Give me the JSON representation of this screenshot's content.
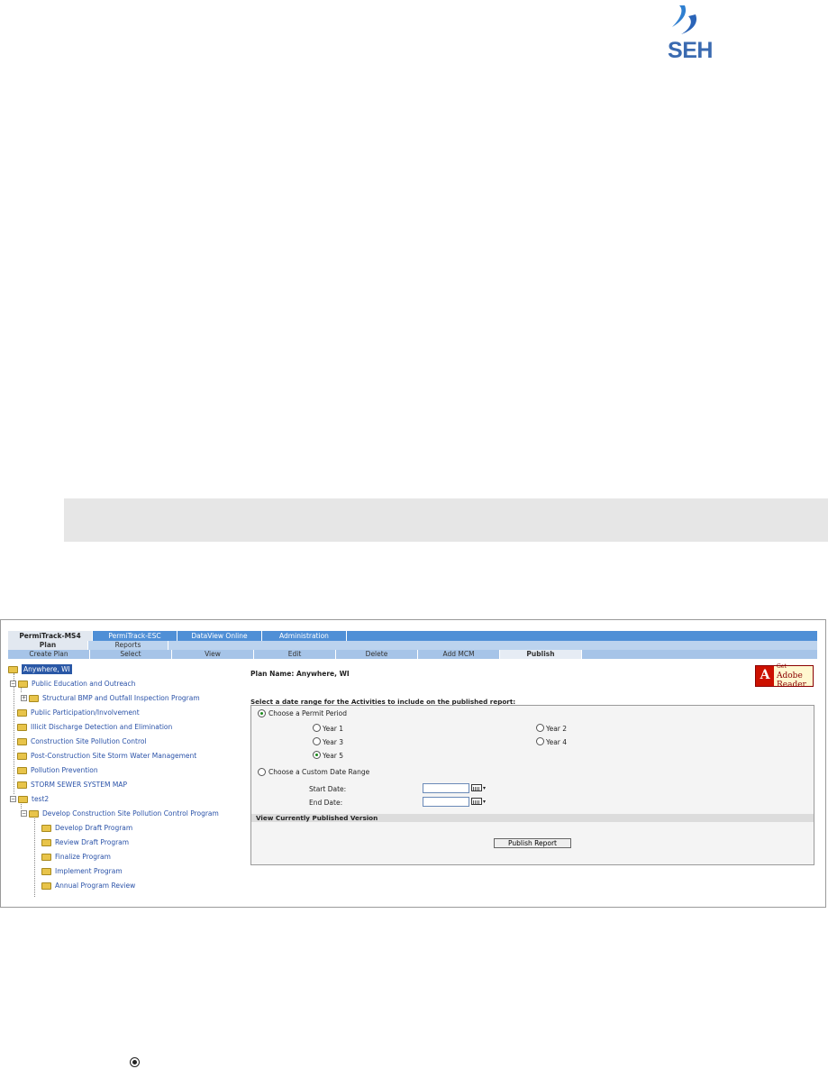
{
  "logo": {
    "text": "SEH",
    "color": "#3a6ab0"
  },
  "nav": {
    "products": [
      "PermiTrack-MS4",
      "PermiTrack-ESC",
      "DataView Online",
      "Administration"
    ],
    "sections": [
      "Plan",
      "Reports"
    ],
    "actions": [
      "Create Plan",
      "Select",
      "View",
      "Edit",
      "Delete",
      "Add MCM",
      "Publish"
    ]
  },
  "tree": {
    "root": "Anywhere, WI",
    "items": [
      "Public Education and Outreach",
      "Structural BMP and Outfall Inspection Program",
      "Public Participation/Involvement",
      "Illicit Discharge Detection and Elimination",
      "Construction Site Pollution Control",
      "Post-Construction Site Storm Water Management",
      "Pollution Prevention",
      "STORM SEWER SYSTEM MAP",
      "test2",
      "Develop Construction Site Pollution Control Program",
      "Develop Draft Program",
      "Review Draft Program",
      "Finalize Program",
      "Implement Program",
      "Annual Program Review"
    ]
  },
  "main": {
    "plan_name_label": "Plan Name:",
    "plan_name": "Anywhere, WI",
    "adobe_get": "Get",
    "adobe_line1": "Adobe",
    "adobe_line2": "Reader",
    "date_prompt": "Select a date range for the Activities to include on the published report:",
    "permit_period_label": "Choose a Permit Period",
    "years": [
      "Year 1",
      "Year 2",
      "Year 3",
      "Year 4",
      "Year 5"
    ],
    "selected_year": "Year 5",
    "custom_range_label": "Choose a Custom Date Range",
    "start_date_label": "Start Date:",
    "end_date_label": "End Date:",
    "start_date_value": "",
    "end_date_value": "",
    "view_published": "View Currently Published Version",
    "publish_button": "Publish Report"
  }
}
